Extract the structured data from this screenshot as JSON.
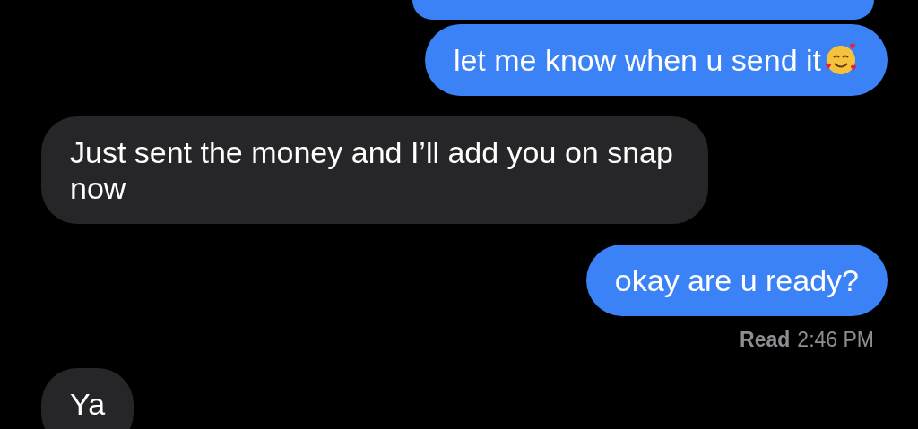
{
  "partial_bubble_above": {
    "kind": "sent"
  },
  "messages": [
    {
      "kind": "sent",
      "text": "let me know when u send it",
      "has_emoji": true
    },
    {
      "kind": "received",
      "text": "Just sent the money and I’ll add you on snap now",
      "has_emoji": false
    },
    {
      "kind": "sent",
      "text": "okay are u ready?",
      "has_emoji": false
    }
  ],
  "receipt": {
    "label": "Read",
    "time": "2:46 PM"
  },
  "last_message": {
    "kind": "received",
    "text": "Ya"
  }
}
